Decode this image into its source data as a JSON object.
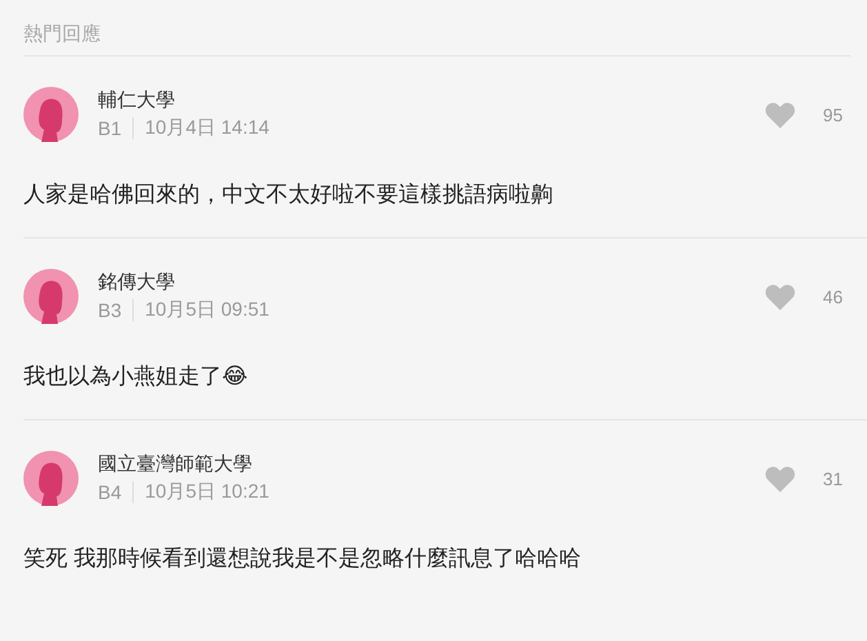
{
  "section_title": "熱門回應",
  "comments": [
    {
      "school": "輔仁大學",
      "floor": "B1",
      "time": "10月4日 14:14",
      "likes": "95",
      "text": "人家是哈佛回來的，中文不太好啦不要這樣挑語病啦齁"
    },
    {
      "school": "銘傳大學",
      "floor": "B3",
      "time": "10月5日 09:51",
      "likes": "46",
      "text": "我也以為小燕姐走了😂"
    },
    {
      "school": "國立臺灣師範大學",
      "floor": "B4",
      "time": "10月5日 10:21",
      "likes": "31",
      "text": "笑死 我那時候看到還想說我是不是忽略什麼訊息了哈哈哈"
    }
  ]
}
